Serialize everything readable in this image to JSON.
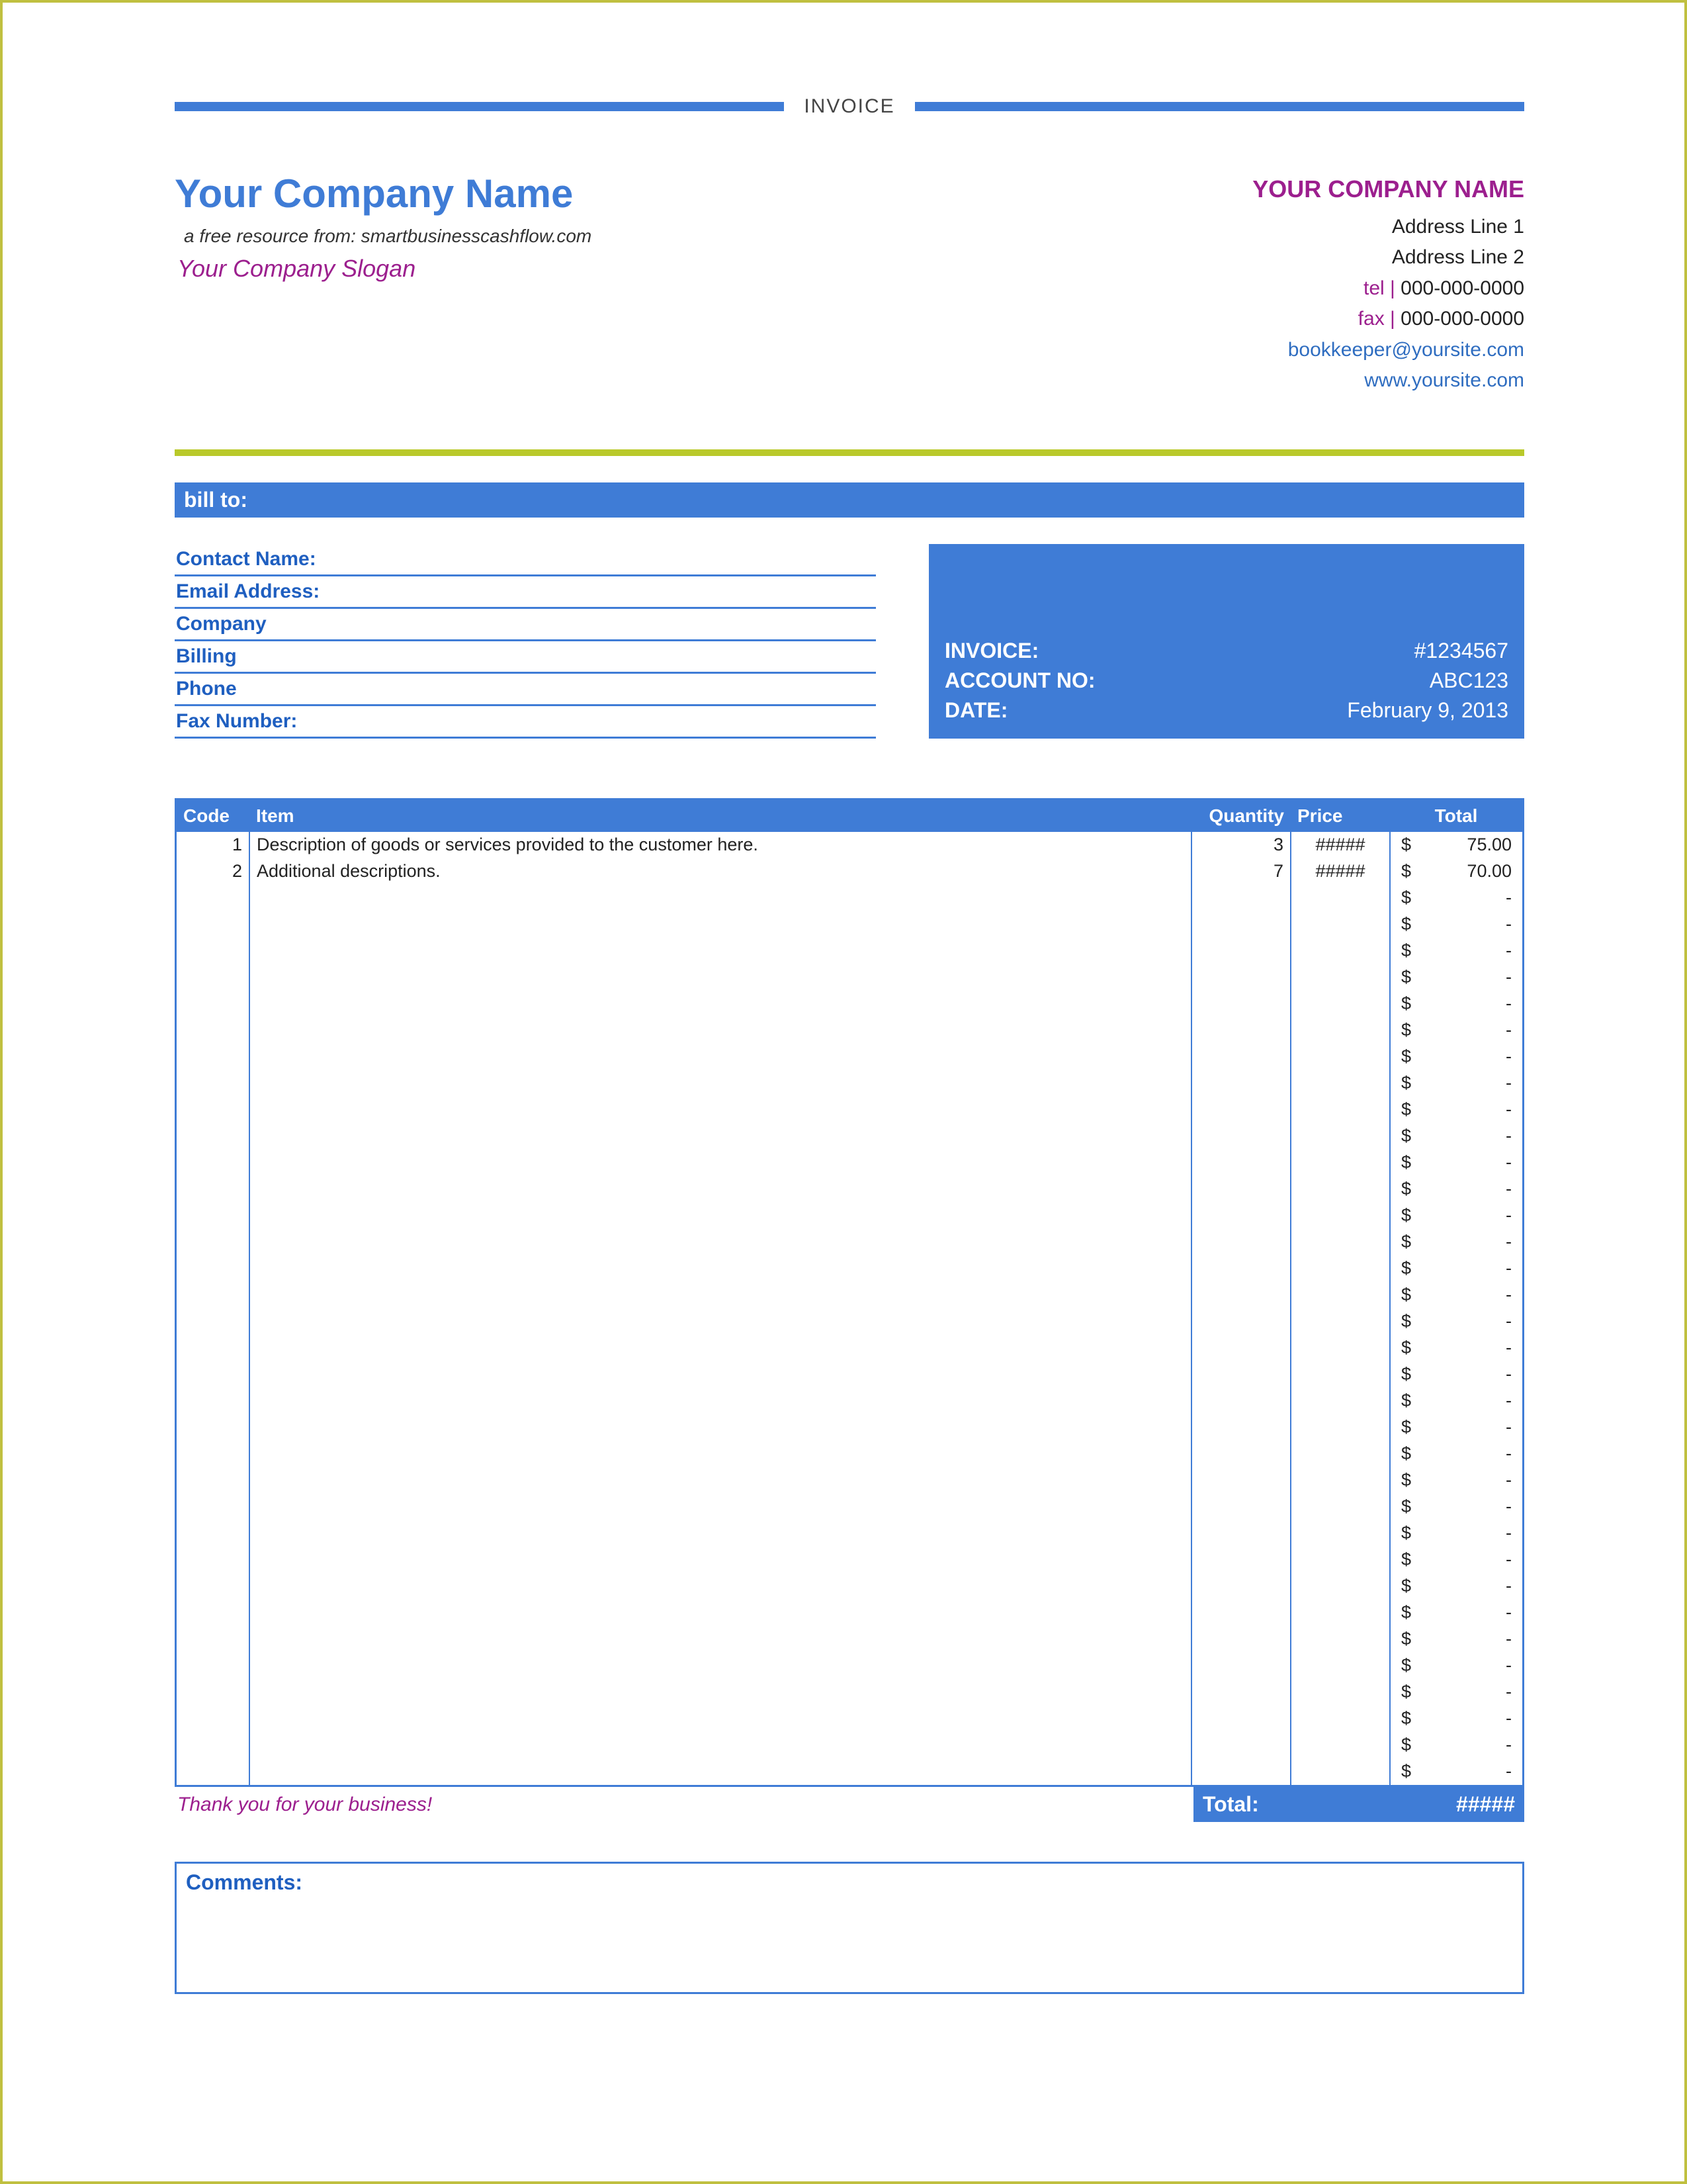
{
  "doc_title": "INVOICE",
  "header": {
    "company_name": "Your Company Name",
    "resource_line": "a free resource from: smartbusinesscashflow.com",
    "slogan": "Your Company Slogan",
    "right": {
      "company_name": "YOUR COMPANY NAME",
      "address1": "Address Line 1",
      "address2": "Address Line 2",
      "tel_label": "tel |",
      "tel": "000-000-0000",
      "fax_label": "fax |",
      "fax": "000-000-0000",
      "email": "bookkeeper@yoursite.com",
      "website": "www.yoursite.com"
    }
  },
  "billto": {
    "bar_label": "bill to:",
    "fields": [
      "Contact Name:",
      "Email Address:",
      "Company",
      "Billing",
      "Phone",
      "Fax Number:"
    ]
  },
  "invoice_box": {
    "invoice_label": "INVOICE:",
    "invoice_no": "#1234567",
    "account_label": "ACCOUNT NO:",
    "account_no": "ABC123",
    "date_label": "DATE:",
    "date": "February 9, 2013"
  },
  "items": {
    "headers": {
      "code": "Code",
      "item": "Item",
      "qty": "Quantity",
      "price": "Price",
      "total": "Total"
    },
    "rows": [
      {
        "code": "1",
        "item": "Description of goods or services provided to the customer here.",
        "qty": "3",
        "price": "#####",
        "total": "75.00"
      },
      {
        "code": "2",
        "item": "Additional descriptions.",
        "qty": "7",
        "price": "#####",
        "total": "70.00"
      },
      {
        "code": "",
        "item": "",
        "qty": "",
        "price": "",
        "total": "-"
      },
      {
        "code": "",
        "item": "",
        "qty": "",
        "price": "",
        "total": "-"
      },
      {
        "code": "",
        "item": "",
        "qty": "",
        "price": "",
        "total": "-"
      },
      {
        "code": "",
        "item": "",
        "qty": "",
        "price": "",
        "total": "-"
      },
      {
        "code": "",
        "item": "",
        "qty": "",
        "price": "",
        "total": "-"
      },
      {
        "code": "",
        "item": "",
        "qty": "",
        "price": "",
        "total": "-"
      },
      {
        "code": "",
        "item": "",
        "qty": "",
        "price": "",
        "total": "-"
      },
      {
        "code": "",
        "item": "",
        "qty": "",
        "price": "",
        "total": "-"
      },
      {
        "code": "",
        "item": "",
        "qty": "",
        "price": "",
        "total": "-"
      },
      {
        "code": "",
        "item": "",
        "qty": "",
        "price": "",
        "total": "-"
      },
      {
        "code": "",
        "item": "",
        "qty": "",
        "price": "",
        "total": "-"
      },
      {
        "code": "",
        "item": "",
        "qty": "",
        "price": "",
        "total": "-"
      },
      {
        "code": "",
        "item": "",
        "qty": "",
        "price": "",
        "total": "-"
      },
      {
        "code": "",
        "item": "",
        "qty": "",
        "price": "",
        "total": "-"
      },
      {
        "code": "",
        "item": "",
        "qty": "",
        "price": "",
        "total": "-"
      },
      {
        "code": "",
        "item": "",
        "qty": "",
        "price": "",
        "total": "-"
      },
      {
        "code": "",
        "item": "",
        "qty": "",
        "price": "",
        "total": "-"
      },
      {
        "code": "",
        "item": "",
        "qty": "",
        "price": "",
        "total": "-"
      },
      {
        "code": "",
        "item": "",
        "qty": "",
        "price": "",
        "total": "-"
      },
      {
        "code": "",
        "item": "",
        "qty": "",
        "price": "",
        "total": "-"
      },
      {
        "code": "",
        "item": "",
        "qty": "",
        "price": "",
        "total": "-"
      },
      {
        "code": "",
        "item": "",
        "qty": "",
        "price": "",
        "total": "-"
      },
      {
        "code": "",
        "item": "",
        "qty": "",
        "price": "",
        "total": "-"
      },
      {
        "code": "",
        "item": "",
        "qty": "",
        "price": "",
        "total": "-"
      },
      {
        "code": "",
        "item": "",
        "qty": "",
        "price": "",
        "total": "-"
      },
      {
        "code": "",
        "item": "",
        "qty": "",
        "price": "",
        "total": "-"
      },
      {
        "code": "",
        "item": "",
        "qty": "",
        "price": "",
        "total": "-"
      },
      {
        "code": "",
        "item": "",
        "qty": "",
        "price": "",
        "total": "-"
      },
      {
        "code": "",
        "item": "",
        "qty": "",
        "price": "",
        "total": "-"
      },
      {
        "code": "",
        "item": "",
        "qty": "",
        "price": "",
        "total": "-"
      },
      {
        "code": "",
        "item": "",
        "qty": "",
        "price": "",
        "total": "-"
      },
      {
        "code": "",
        "item": "",
        "qty": "",
        "price": "",
        "total": "-"
      },
      {
        "code": "",
        "item": "",
        "qty": "",
        "price": "",
        "total": "-"
      },
      {
        "code": "",
        "item": "",
        "qty": "",
        "price": "",
        "total": "-"
      }
    ],
    "currency": "$",
    "thank_you": "Thank you for your business!",
    "total_label": "Total:",
    "total_value": "#####"
  },
  "comments_label": "Comments:"
}
